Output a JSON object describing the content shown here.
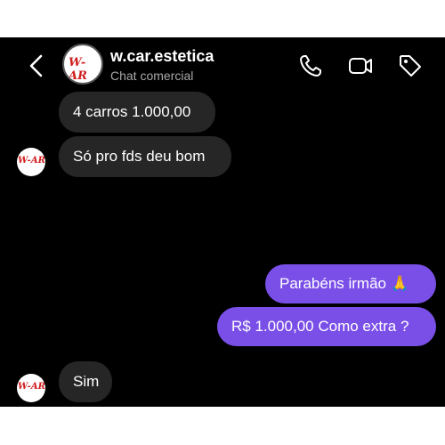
{
  "header": {
    "name": "w.car.estetica",
    "subtitle": "Chat comercial",
    "avatar_text": "W-AR"
  },
  "icons": {
    "back": "chevron-left-icon",
    "call": "phone-icon",
    "video": "video-camera-icon",
    "tag": "tag-icon"
  },
  "messages": [
    {
      "from": "them",
      "text": "4 carros 1.000,00"
    },
    {
      "from": "them",
      "text": "Só pro fds deu bom"
    },
    {
      "from": "me",
      "emoji": "😱 😱"
    },
    {
      "from": "me",
      "text": "Parabéns irmão 🙏"
    },
    {
      "from": "me",
      "text": "R$ 1.000,00 Como extra ?"
    },
    {
      "from": "them",
      "text": "Sim"
    }
  ],
  "colors": {
    "background": "#000000",
    "incoming_bubble": "#262626",
    "outgoing_bubble": "#7a4fe8",
    "logo_red": "#d02020"
  }
}
